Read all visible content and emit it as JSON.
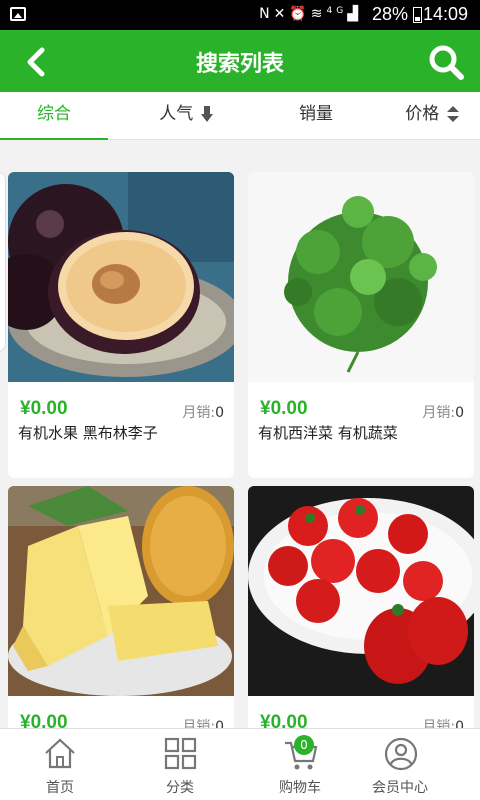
{
  "status_bar": {
    "network": "4G",
    "battery": "28%",
    "time": "14:09"
  },
  "header": {
    "title": "搜索列表",
    "back_icon": "chevron-left-icon",
    "search_icon": "search-icon"
  },
  "sort_tabs": [
    {
      "label": "综合",
      "active": true
    },
    {
      "label": "人气",
      "icon": "arrow-down-icon"
    },
    {
      "label": "销量"
    },
    {
      "label": "价格",
      "icon": "sort-icon"
    }
  ],
  "products": [
    {
      "price": "¥0.00",
      "sales_label": "月销:",
      "sales_count": "0",
      "name": "有机水果 黑布林李子"
    },
    {
      "price": "¥0.00",
      "sales_label": "月销:",
      "sales_count": "0",
      "name": "有机西洋菜 有机蔬菜"
    },
    {
      "price": "¥0.00",
      "sales_label": "月销:",
      "sales_count": "0",
      "name": ""
    },
    {
      "price": "¥0.00",
      "sales_label": "月销:",
      "sales_count": "0",
      "name": ""
    }
  ],
  "bottom_nav": [
    {
      "label": "首页",
      "icon": "home-icon"
    },
    {
      "label": "分类",
      "icon": "category-grid-icon"
    },
    {
      "label": "购物车",
      "icon": "cart-icon",
      "badge": "0"
    },
    {
      "label": "会员中心",
      "icon": "user-icon"
    }
  ],
  "colors": {
    "accent": "#2ab32a",
    "background": "#f2f2f2"
  }
}
